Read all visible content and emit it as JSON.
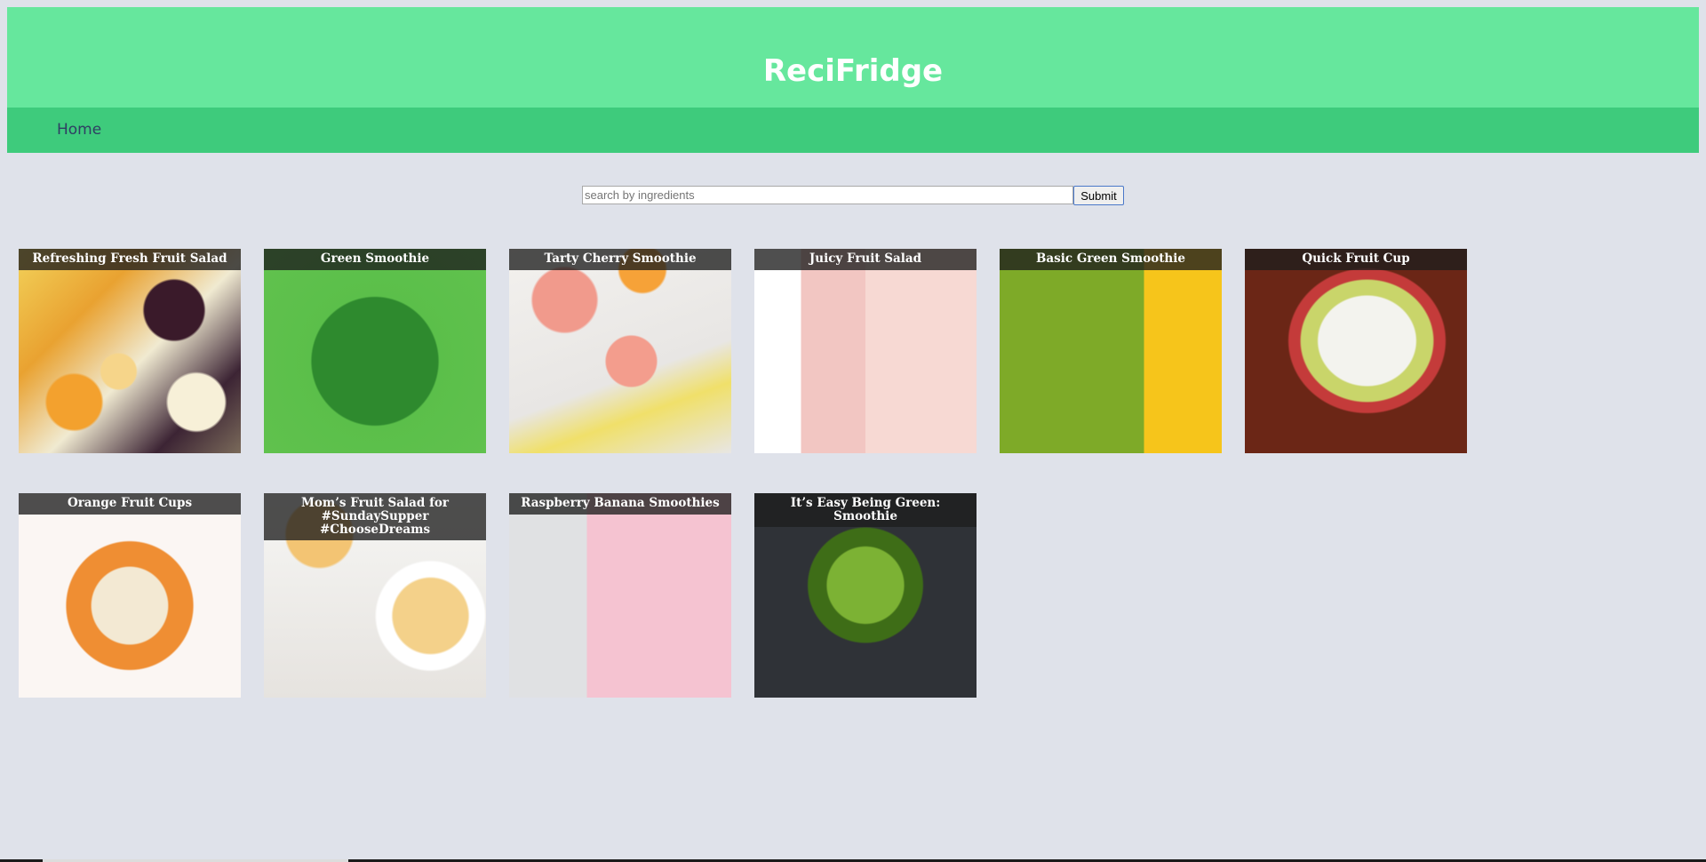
{
  "header": {
    "title": "ReciFridge"
  },
  "nav": {
    "home": "Home"
  },
  "search": {
    "placeholder": "search by ingredients",
    "value": "",
    "submit_label": "Submit"
  },
  "recipes": [
    {
      "title": "Refreshing Fresh Fruit Salad"
    },
    {
      "title": "Green Smoothie"
    },
    {
      "title": "Tarty Cherry Smoothie"
    },
    {
      "title": "Juicy Fruit Salad"
    },
    {
      "title": "Basic Green Smoothie"
    },
    {
      "title": "Quick Fruit Cup"
    },
    {
      "title": "Orange Fruit Cups"
    },
    {
      "title": "Mom’s Fruit Salad for #SundaySupper #ChooseDreams"
    },
    {
      "title": "Raspberry Banana Smoothies"
    },
    {
      "title": "It’s Easy Being Green: Smoothie"
    }
  ]
}
